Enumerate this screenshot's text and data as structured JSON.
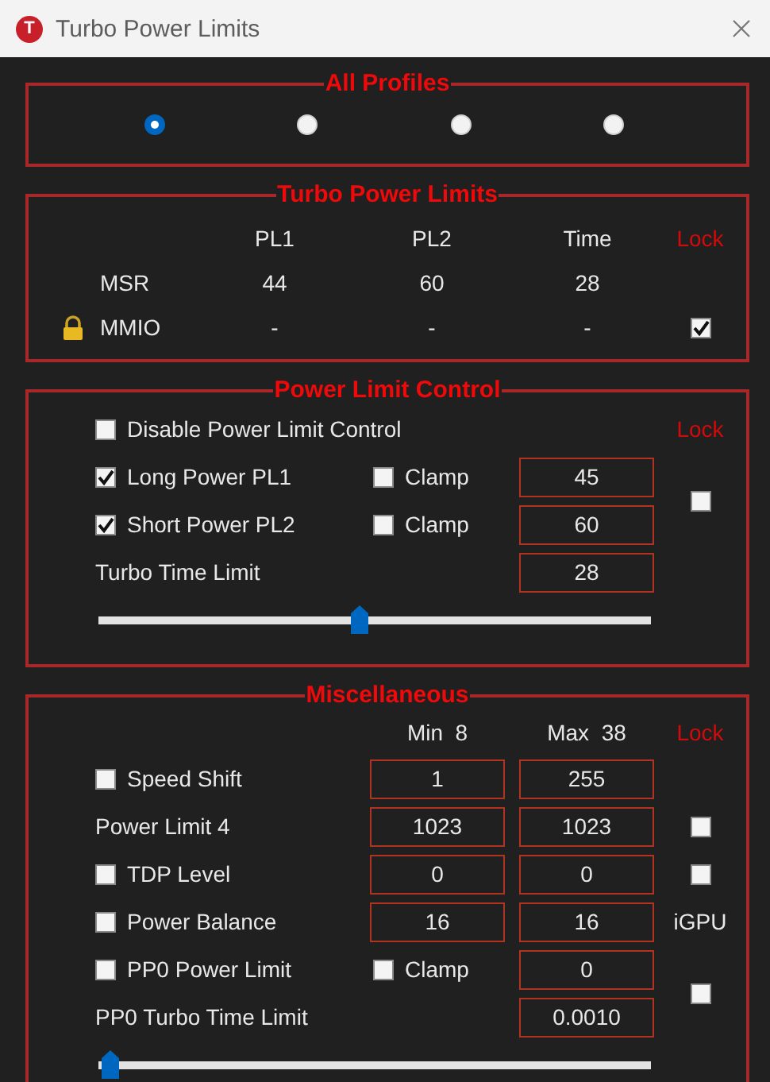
{
  "window": {
    "title": "Turbo Power Limits",
    "logo": "T"
  },
  "profiles": {
    "title": "All Profiles",
    "options": [
      {
        "selected": true
      },
      {
        "selected": false
      },
      {
        "selected": false
      },
      {
        "selected": false
      }
    ]
  },
  "turbo_power_limits": {
    "title": "Turbo Power Limits",
    "columns": [
      "PL1",
      "PL2",
      "Time"
    ],
    "lock_label": "Lock",
    "rows": [
      {
        "label": "MSR",
        "locked": false,
        "values": [
          "44",
          "60",
          "28"
        ]
      },
      {
        "label": "MMIO",
        "locked": true,
        "values": [
          "-",
          "-",
          "-"
        ],
        "lock": {
          "checked": true
        }
      }
    ]
  },
  "power_limit_control": {
    "title": "Power Limit Control",
    "lock_label": "Lock",
    "disable": {
      "label": "Disable Power Limit Control",
      "checked": false
    },
    "rows": [
      {
        "label": "Long Power PL1",
        "checked": true,
        "clamp": {
          "label": "Clamp",
          "checked": false
        },
        "value": "45"
      },
      {
        "label": "Short Power PL2",
        "checked": true,
        "clamp": {
          "label": "Clamp",
          "checked": false
        },
        "value": "60"
      }
    ],
    "lock": {
      "checked": false
    },
    "time_limit": {
      "label": "Turbo Time Limit",
      "value": "28"
    },
    "slider": {
      "level": 0.47
    }
  },
  "miscellaneous": {
    "title": "Miscellaneous",
    "columns": [
      "Min  8",
      "Max  38"
    ],
    "lock_label": "Lock",
    "rows": [
      {
        "kind": "check",
        "label": "Speed Shift",
        "checked": false,
        "min": "1",
        "max": "255"
      },
      {
        "kind": "plain",
        "label": "Power Limit 4",
        "min": "1023",
        "max": "1023",
        "lock": {
          "checked": false
        }
      },
      {
        "kind": "check",
        "label": "TDP Level",
        "checked": false,
        "min": "0",
        "max": "0",
        "lock": {
          "checked": false
        }
      },
      {
        "kind": "check",
        "label": "Power Balance",
        "checked": false,
        "min": "16",
        "max": "16",
        "side_label": "iGPU"
      },
      {
        "kind": "clamp",
        "label": "PP0 Power Limit",
        "checked": false,
        "clamp": {
          "label": "Clamp",
          "checked": false
        },
        "value": "0"
      },
      {
        "kind": "plain",
        "label": "PP0 Turbo Time Limit",
        "value": "0.0010"
      }
    ],
    "pp0_lock": {
      "checked": false
    },
    "slider": {
      "level": 0.02
    }
  }
}
